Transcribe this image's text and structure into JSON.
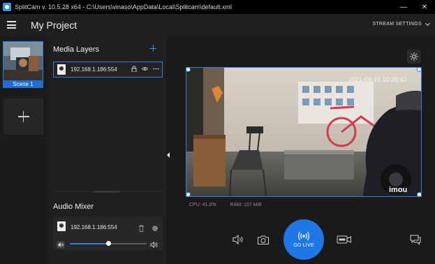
{
  "window": {
    "title": "SplitCam v. 10.5.28 x64 - C:\\Users\\vinaso\\AppData\\Local\\Splitcam\\default.xml",
    "minimize": "—",
    "close": "✕"
  },
  "header": {
    "project_title": "My Project",
    "stream_settings": "STREAM SETTINGS"
  },
  "scenes": {
    "items": [
      {
        "label": "Scene 1"
      }
    ]
  },
  "layers": {
    "title": "Media Layers",
    "items": [
      {
        "name": "192.168.1.186:554"
      }
    ]
  },
  "mixer": {
    "title": "Audio Mixer",
    "items": [
      {
        "name": "192.168.1.186:554",
        "volume": 0.5
      }
    ]
  },
  "preview": {
    "timestamp": "2021-08-15 10:26:42",
    "watermark": "imou",
    "cpu": "CPU: 41.0%",
    "ram": "RAM: 157 MiB"
  },
  "controls": {
    "go_live_label": "GO LIVE"
  },
  "colors": {
    "accent": "#1f77e6",
    "background": "#1b1b1b",
    "panel": "#1f1f1f"
  }
}
